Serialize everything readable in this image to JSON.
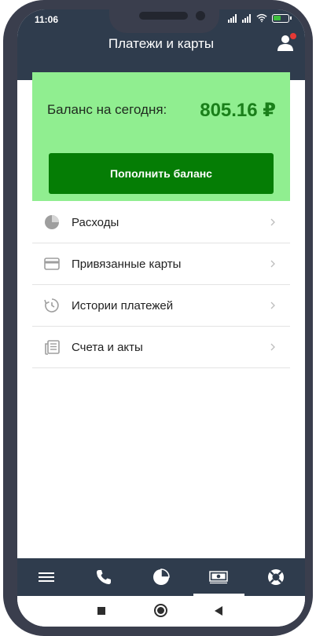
{
  "status_bar": {
    "time": "11:06",
    "icons": [
      "signal-icon",
      "signal-icon",
      "wifi-icon",
      "battery-icon"
    ]
  },
  "header": {
    "title": "Платежи и карты",
    "profile_icon": "profile-icon",
    "notification_color": "#e53935"
  },
  "balance": {
    "label": "Баланс на сегодня:",
    "value": "805.16 ₽",
    "topup_label": "Пополнить баланс",
    "card_color": "#90ee90",
    "button_color": "#057d05",
    "value_color": "#1a7f1a"
  },
  "menu": {
    "items": [
      {
        "label": "Расходы",
        "icon": "pie-chart-icon"
      },
      {
        "label": "Привязанные карты",
        "icon": "credit-card-icon"
      },
      {
        "label": "Истории платежей",
        "icon": "history-icon"
      },
      {
        "label": "Счета и акты",
        "icon": "documents-icon"
      }
    ]
  },
  "bottom_nav": {
    "items": [
      {
        "icon": "menu-icon",
        "active": false
      },
      {
        "icon": "phone-icon",
        "active": false
      },
      {
        "icon": "pie-chart-icon",
        "active": false
      },
      {
        "icon": "money-icon",
        "active": true
      },
      {
        "icon": "lifebuoy-icon",
        "active": false
      }
    ],
    "background": "#2f3c4d"
  },
  "system_nav": {
    "icons": [
      "recent-apps-icon",
      "home-icon",
      "back-icon"
    ]
  }
}
